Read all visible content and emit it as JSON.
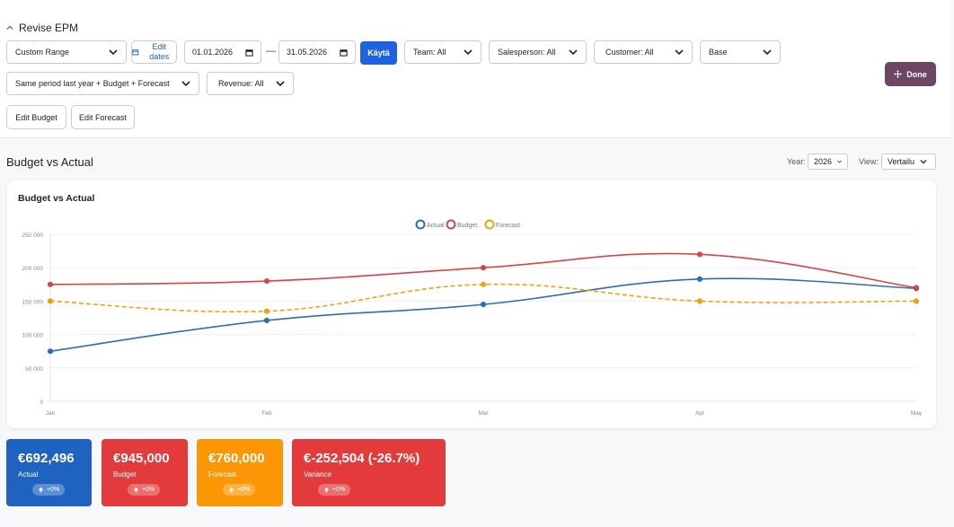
{
  "header": {
    "title": "Revise EPM"
  },
  "filters": {
    "range": "Custom Range",
    "edit_dates": "Edit dates",
    "date_from": "01.01.2026",
    "date_sep": "—",
    "date_to": "31.05.2026",
    "apply": "Käytä",
    "team": "Team: All",
    "salesperson": "Salesperson: All",
    "customer": "Customer: All",
    "base": "Base",
    "comparison": "Same period last year + Budget + Forecast",
    "revenue": "Revenue: All",
    "edit_budget": "Edit Budget",
    "edit_forecast": "Edit Forecast",
    "done": "Done"
  },
  "section": {
    "title": "Budget vs Actual",
    "year_label": "Year:",
    "year_value": "2026",
    "view_label": "View:",
    "view_value": "Vertailu"
  },
  "card": {
    "title": "Budget vs Actual"
  },
  "chart_data": {
    "type": "line",
    "categories": [
      "Jan",
      "Feb",
      "Mar",
      "Apr",
      "May"
    ],
    "ylim": [
      0,
      250000
    ],
    "yticks": [
      0,
      50000,
      100000,
      150000,
      200000,
      250000
    ],
    "ytick_labels": [
      "0",
      "50 000",
      "100 000",
      "150 000",
      "200 000",
      "250 000"
    ],
    "legend_position": "top-center",
    "grid": true,
    "series": [
      {
        "name": "Actual",
        "color": "#2f6db3",
        "dashed": false,
        "values": [
          75000,
          121000,
          145000,
          183000,
          169000
        ]
      },
      {
        "name": "Budget",
        "color": "#d64545",
        "dashed": false,
        "values": [
          175000,
          180000,
          200000,
          220000,
          170000
        ]
      },
      {
        "name": "Forecast",
        "color": "#f0a20f",
        "dashed": true,
        "values": [
          150000,
          135000,
          175000,
          150000,
          150000
        ]
      }
    ]
  },
  "kpis": [
    {
      "value": "€692,496",
      "label": "Actual",
      "change": "+0%",
      "color": "#1e63c0"
    },
    {
      "value": "€945,000",
      "label": "Budget",
      "change": "+0%",
      "color": "#e33b3b"
    },
    {
      "value": "€760,000",
      "label": "Forecast",
      "change": "+0%",
      "color": "#fb9705"
    },
    {
      "value": "€-252,504 (-26.7%)",
      "label": "Variance",
      "change": "+0%",
      "color": "#e33b3b"
    }
  ]
}
